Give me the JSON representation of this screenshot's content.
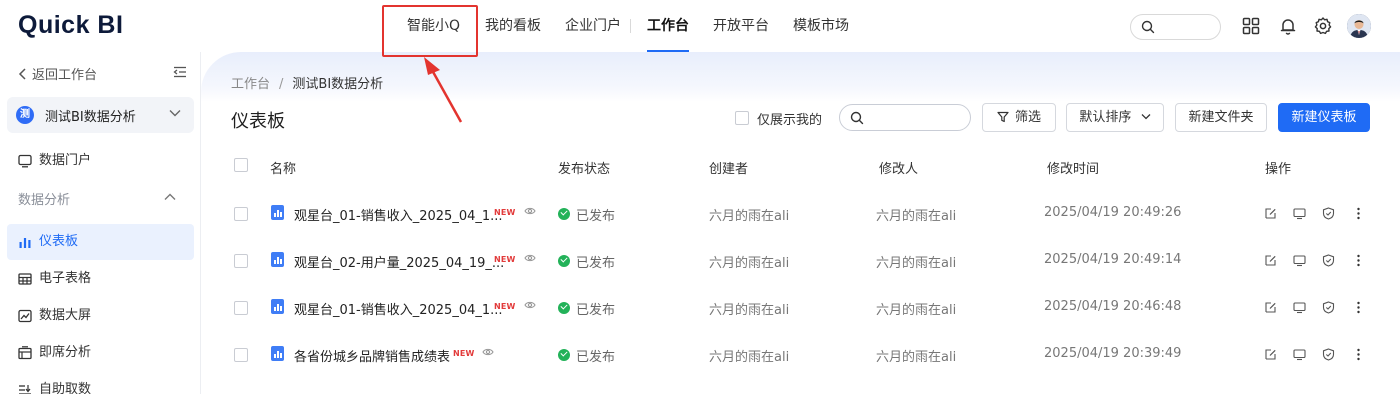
{
  "app": {
    "logo": "Quick BI"
  },
  "topnav": {
    "items": [
      {
        "label": "智能小Q"
      },
      {
        "label": "我的看板"
      },
      {
        "label": "企业门户"
      },
      {
        "label": "工作台"
      },
      {
        "label": "开放平台"
      },
      {
        "label": "模板市场"
      }
    ],
    "active": "工作台"
  },
  "sidebar": {
    "back_label": "返回工作台",
    "workspace": {
      "badge": "测",
      "name": "测试BI数据分析"
    },
    "portal_label": "数据门户",
    "group_label": "数据分析",
    "items": [
      {
        "label": "仪表板",
        "active": true
      },
      {
        "label": "电子表格"
      },
      {
        "label": "数据大屏"
      },
      {
        "label": "即席分析"
      },
      {
        "label": "自助取数"
      }
    ]
  },
  "main": {
    "breadcrumb": {
      "root": "工作台",
      "sep": "/",
      "current": "测试BI数据分析"
    },
    "title": "仪表板",
    "only_mine_label": "仅展示我的",
    "filter_label": "筛选",
    "sort_label": "默认排序",
    "new_folder_label": "新建文件夹",
    "new_dashboard_label": "新建仪表板"
  },
  "table": {
    "columns": {
      "name": "名称",
      "status": "发布状态",
      "creator": "创建者",
      "modifier": "修改人",
      "mtime": "修改时间",
      "ops": "操作"
    },
    "new_tag": "NEW",
    "rows": [
      {
        "name": "观星台_01-销售收入_2025_04_1...",
        "status": "已发布",
        "creator": "六月的雨在ali",
        "modifier": "六月的雨在ali",
        "mtime": "2025/04/19 20:49:26"
      },
      {
        "name": "观星台_02-用户量_2025_04_19_...",
        "status": "已发布",
        "creator": "六月的雨在ali",
        "modifier": "六月的雨在ali",
        "mtime": "2025/04/19 20:49:14"
      },
      {
        "name": "观星台_01-销售收入_2025_04_1...",
        "status": "已发布",
        "creator": "六月的雨在ali",
        "modifier": "六月的雨在ali",
        "mtime": "2025/04/19 20:46:48"
      },
      {
        "name": "各省份城乡品牌销售成绩表",
        "status": "已发布",
        "creator": "六月的雨在ali",
        "modifier": "六月的雨在ali",
        "mtime": "2025/04/19 20:39:49"
      }
    ]
  },
  "colors": {
    "accent": "#1f6bf5",
    "published": "#23b259",
    "new_tag": "#e23b3b",
    "annotation": "#e3342f"
  }
}
